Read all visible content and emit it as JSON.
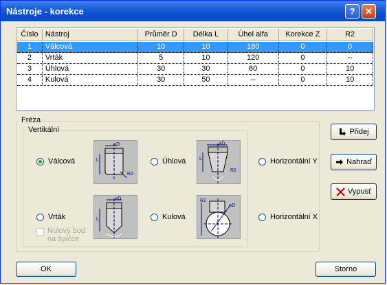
{
  "window": {
    "title": "Nástroje - korekce",
    "help_label": "?",
    "close_label": "✕"
  },
  "table": {
    "headers": [
      "Číslo",
      "Nástroj",
      "Průměr D",
      "Délka L",
      "Úhel alfa",
      "Korekce Z",
      "R2"
    ],
    "rows": [
      [
        "1",
        "Válcová",
        "10",
        "10",
        "180",
        "0",
        "0"
      ],
      [
        "2",
        "Vrták",
        "5",
        "10",
        "120",
        "0",
        "--"
      ],
      [
        "3",
        "Úhlová",
        "30",
        "30",
        "60",
        "0",
        "10"
      ],
      [
        "4",
        "Kulová",
        "30",
        "50",
        "--",
        "0",
        "10"
      ]
    ],
    "selected_row": 0
  },
  "milling": {
    "group_label": "Fréza",
    "vertical_label": "Vertikální",
    "options": {
      "cylindrical": "Válcová",
      "angular": "Úhlová",
      "horizontal_y": "Horizontální Y",
      "drill": "Vrták",
      "ball": "Kulová",
      "horizontal_x": "Horizontální X"
    },
    "selected": "cylindrical",
    "zero_point_line1": "Nulový bod",
    "zero_point_line2": "na špičce",
    "zero_point_checked": false
  },
  "buttons": {
    "add": "Přidej",
    "replace": "Nahraď",
    "delete": "Vypusť",
    "ok": "OK",
    "cancel": "Storno"
  },
  "icons": {
    "add": "arrow-down-right-icon",
    "replace": "arrow-right-icon",
    "delete": "red-x-icon"
  },
  "diagram_labels": {
    "diameter": "⌀D",
    "length": "L",
    "radius": "R2"
  }
}
